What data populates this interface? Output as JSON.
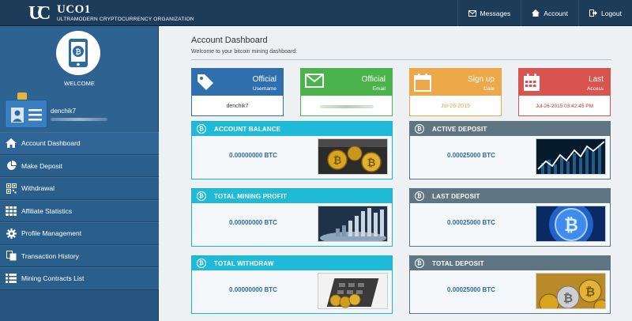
{
  "app": {
    "logo_title": "UCO1",
    "logo_subtitle": "ULTRAMODERN CRYPTOCURRENCY ORGANIZATION"
  },
  "topnav": [
    {
      "label": "Messages",
      "icon": "envelope-icon"
    },
    {
      "label": "Account",
      "icon": "home-icon"
    },
    {
      "label": "Logout",
      "icon": "logout-icon"
    }
  ],
  "sidebar": {
    "welcome": "WELCOME",
    "username": "denchik7",
    "menu": [
      {
        "label": "Account Dashboard",
        "icon": "home-icon"
      },
      {
        "label": "Make Deposit",
        "icon": "pie-chart-icon"
      },
      {
        "label": "Withdrawal",
        "icon": "qr-code-icon"
      },
      {
        "label": "Affiliate Statistics",
        "icon": "grid-icon"
      },
      {
        "label": "Profile Management",
        "icon": "gear-icon"
      },
      {
        "label": "Transaction History",
        "icon": "documents-icon"
      },
      {
        "label": "Mining Contracts List",
        "icon": "list-icon"
      }
    ]
  },
  "main": {
    "title": "Account Dashboard",
    "subtitle": "Welcome to your bitcoin mining dashboard:",
    "stats": [
      {
        "title": "Official",
        "sub": "Username",
        "value": "denchik7",
        "icon": "tags-icon"
      },
      {
        "title": "Official",
        "sub": "Email",
        "value": "",
        "icon": "envelope-icon"
      },
      {
        "title": "Sign up",
        "sub": "Date",
        "value": "Jul-26-2015",
        "icon": "calendar-icon"
      },
      {
        "title": "Last",
        "sub": "Access",
        "value": "Jul-26-2015 03:42:45 PM",
        "icon": "calendar-grid-icon"
      }
    ],
    "panels": [
      {
        "title": "ACCOUNT BALANCE",
        "amount": "0.00000000 BTC",
        "image": "bitcoin-coins-image"
      },
      {
        "title": "ACTIVE DEPOSIT",
        "amount": "0.00025000 BTC",
        "image": "stock-chart-image"
      },
      {
        "title": "TOTAL MINING PROFIT",
        "amount": "0.00000000 BTC",
        "image": "bar-graph-image"
      },
      {
        "title": "LAST DEPOSIT",
        "amount": "0.00025000 BTC",
        "image": "blue-bitcoin-image"
      },
      {
        "title": "TOTAL WITHDRAW",
        "amount": "0.00000000 BTC",
        "image": "coins-calculator-image"
      },
      {
        "title": "TOTAL DEPOSIT",
        "amount": "0.00025000 BTC",
        "image": "gold-bitcoins-image"
      }
    ]
  },
  "colors": {
    "topbar": "#1c3c5a",
    "sidebar": "#26567f",
    "blue": "#2f6fae",
    "green": "#4bb34b",
    "orange": "#eda84a",
    "red": "#d9534f",
    "cyan": "#1ebad8",
    "slate": "#5f7682"
  }
}
